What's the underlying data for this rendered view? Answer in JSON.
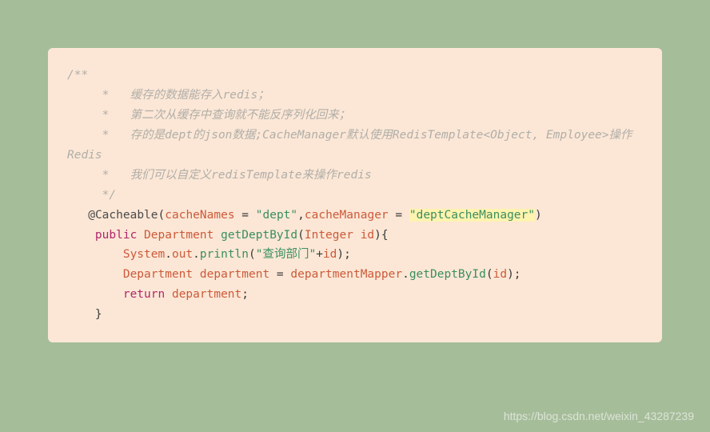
{
  "code": {
    "comment_open": "/**",
    "comment_line1": "     *   缓存的数据能存入redis；",
    "comment_line2": "     *   第二次从缓存中查询就不能反序列化回来；",
    "comment_line3": "     *   存的是dept的json数据;CacheManager默认使用RedisTemplate<Object, Employee>操作Redis",
    "comment_line4": "     *   我们可以自定义redisTemplate来操作redis",
    "comment_close": "     */",
    "annotation_at": "   @",
    "annotation_name": "Cacheable",
    "paren_open": "(",
    "attr1_name": "cacheNames",
    "equals1": " = ",
    "attr1_value": "\"dept\"",
    "comma": ",",
    "attr2_name": "cacheManager",
    "equals2": " = ",
    "attr2_value": "\"deptCacheManager\"",
    "paren_close": ")",
    "method_indent": "    ",
    "kw_public": "public",
    "type_return": "Department",
    "method_name": "getDeptById",
    "type_param": "Integer",
    "param_name": "id",
    "brace_open": "{",
    "body_indent": "        ",
    "sys": "System",
    "dot": ".",
    "out": "out",
    "println": "println",
    "print_str": "\"查询部门\"",
    "plus": "+",
    "print_var": "id",
    "semi": ";",
    "var_type": "Department",
    "var_name": "department",
    "assign": " = ",
    "mapper": "departmentMapper",
    "getDept": "getDeptById",
    "arg": "id",
    "kw_return": "return",
    "ret_var": "department",
    "brace_close_indent": "    ",
    "brace_close": "}"
  },
  "watermark": "https://blog.csdn.net/weixin_43287239"
}
